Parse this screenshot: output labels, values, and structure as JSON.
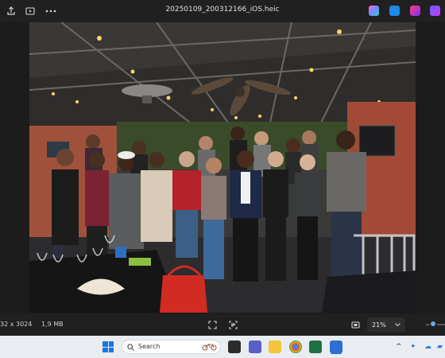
{
  "window": {
    "filename": "20250109_200312166_iOS.heic"
  },
  "bottombar": {
    "dimensions_partial": "32 x 3024",
    "filesize": "1,9 MB",
    "zoom_value": "21%"
  },
  "taskbar": {
    "search_placeholder": "Search"
  },
  "colors": {
    "titlebar_bg": "#202020",
    "taskbar_bg": "#e9edf2",
    "accent": "#6aa9ff"
  }
}
